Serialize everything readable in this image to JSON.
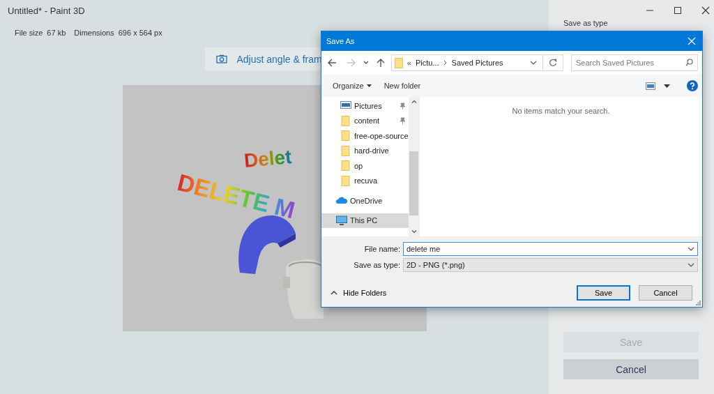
{
  "app": {
    "title": "Untitled* - Paint 3D",
    "file_info": [
      {
        "label": "File size",
        "value": "67 kb"
      },
      {
        "label": "Dimensions",
        "value": "696 x 564 px"
      }
    ],
    "adjust_button": "Adjust angle & fram",
    "canvas_texts": [
      {
        "text": "Delet",
        "kind": "small"
      },
      {
        "text": "DELETE M",
        "kind": "large"
      }
    ],
    "side_panel": {
      "heading": "Save as type",
      "buttons": [
        {
          "label": "Save",
          "disabled": true
        },
        {
          "label": "Cancel",
          "disabled": false
        }
      ]
    }
  },
  "dialog": {
    "title": "Save As",
    "nav": [
      {
        "kind": "back",
        "disabled": false
      },
      {
        "kind": "forward",
        "disabled": true
      },
      {
        "kind": "recent",
        "disabled": false
      },
      {
        "kind": "up",
        "disabled": false
      }
    ],
    "address": {
      "overflow": "«",
      "crumbs": [
        "Pictu...",
        "Saved Pictures"
      ]
    },
    "search": {
      "placeholder": "Search Saved Pictures"
    },
    "toolbar": {
      "organize": "Organize",
      "new_folder": "New folder"
    },
    "tree": [
      {
        "label": "Pictures",
        "kind": "pictures",
        "pinned": true,
        "selected": false
      },
      {
        "label": "content",
        "kind": "folder",
        "pinned": true,
        "selected": false
      },
      {
        "label": "free-ope-source",
        "kind": "folder",
        "pinned": false,
        "selected": false
      },
      {
        "label": "hard-drive",
        "kind": "folder",
        "pinned": false,
        "selected": false
      },
      {
        "label": "op",
        "kind": "folder",
        "pinned": false,
        "selected": false
      },
      {
        "label": "recuva",
        "kind": "folder",
        "pinned": false,
        "selected": false
      },
      {
        "label": "OneDrive",
        "kind": "cloud",
        "pinned": false,
        "selected": false
      },
      {
        "label": "This PC",
        "kind": "pc",
        "pinned": false,
        "selected": true
      }
    ],
    "empty_message": "No items match your search.",
    "fields": [
      {
        "label": "File name:",
        "value": "delete me",
        "focused": true
      },
      {
        "label": "Save as type:",
        "value": "2D - PNG (*.png)",
        "focused": false
      }
    ],
    "hide_folders": "Hide Folders",
    "buttons": [
      {
        "label": "Save",
        "default": true
      },
      {
        "label": "Cancel",
        "default": false
      }
    ]
  }
}
